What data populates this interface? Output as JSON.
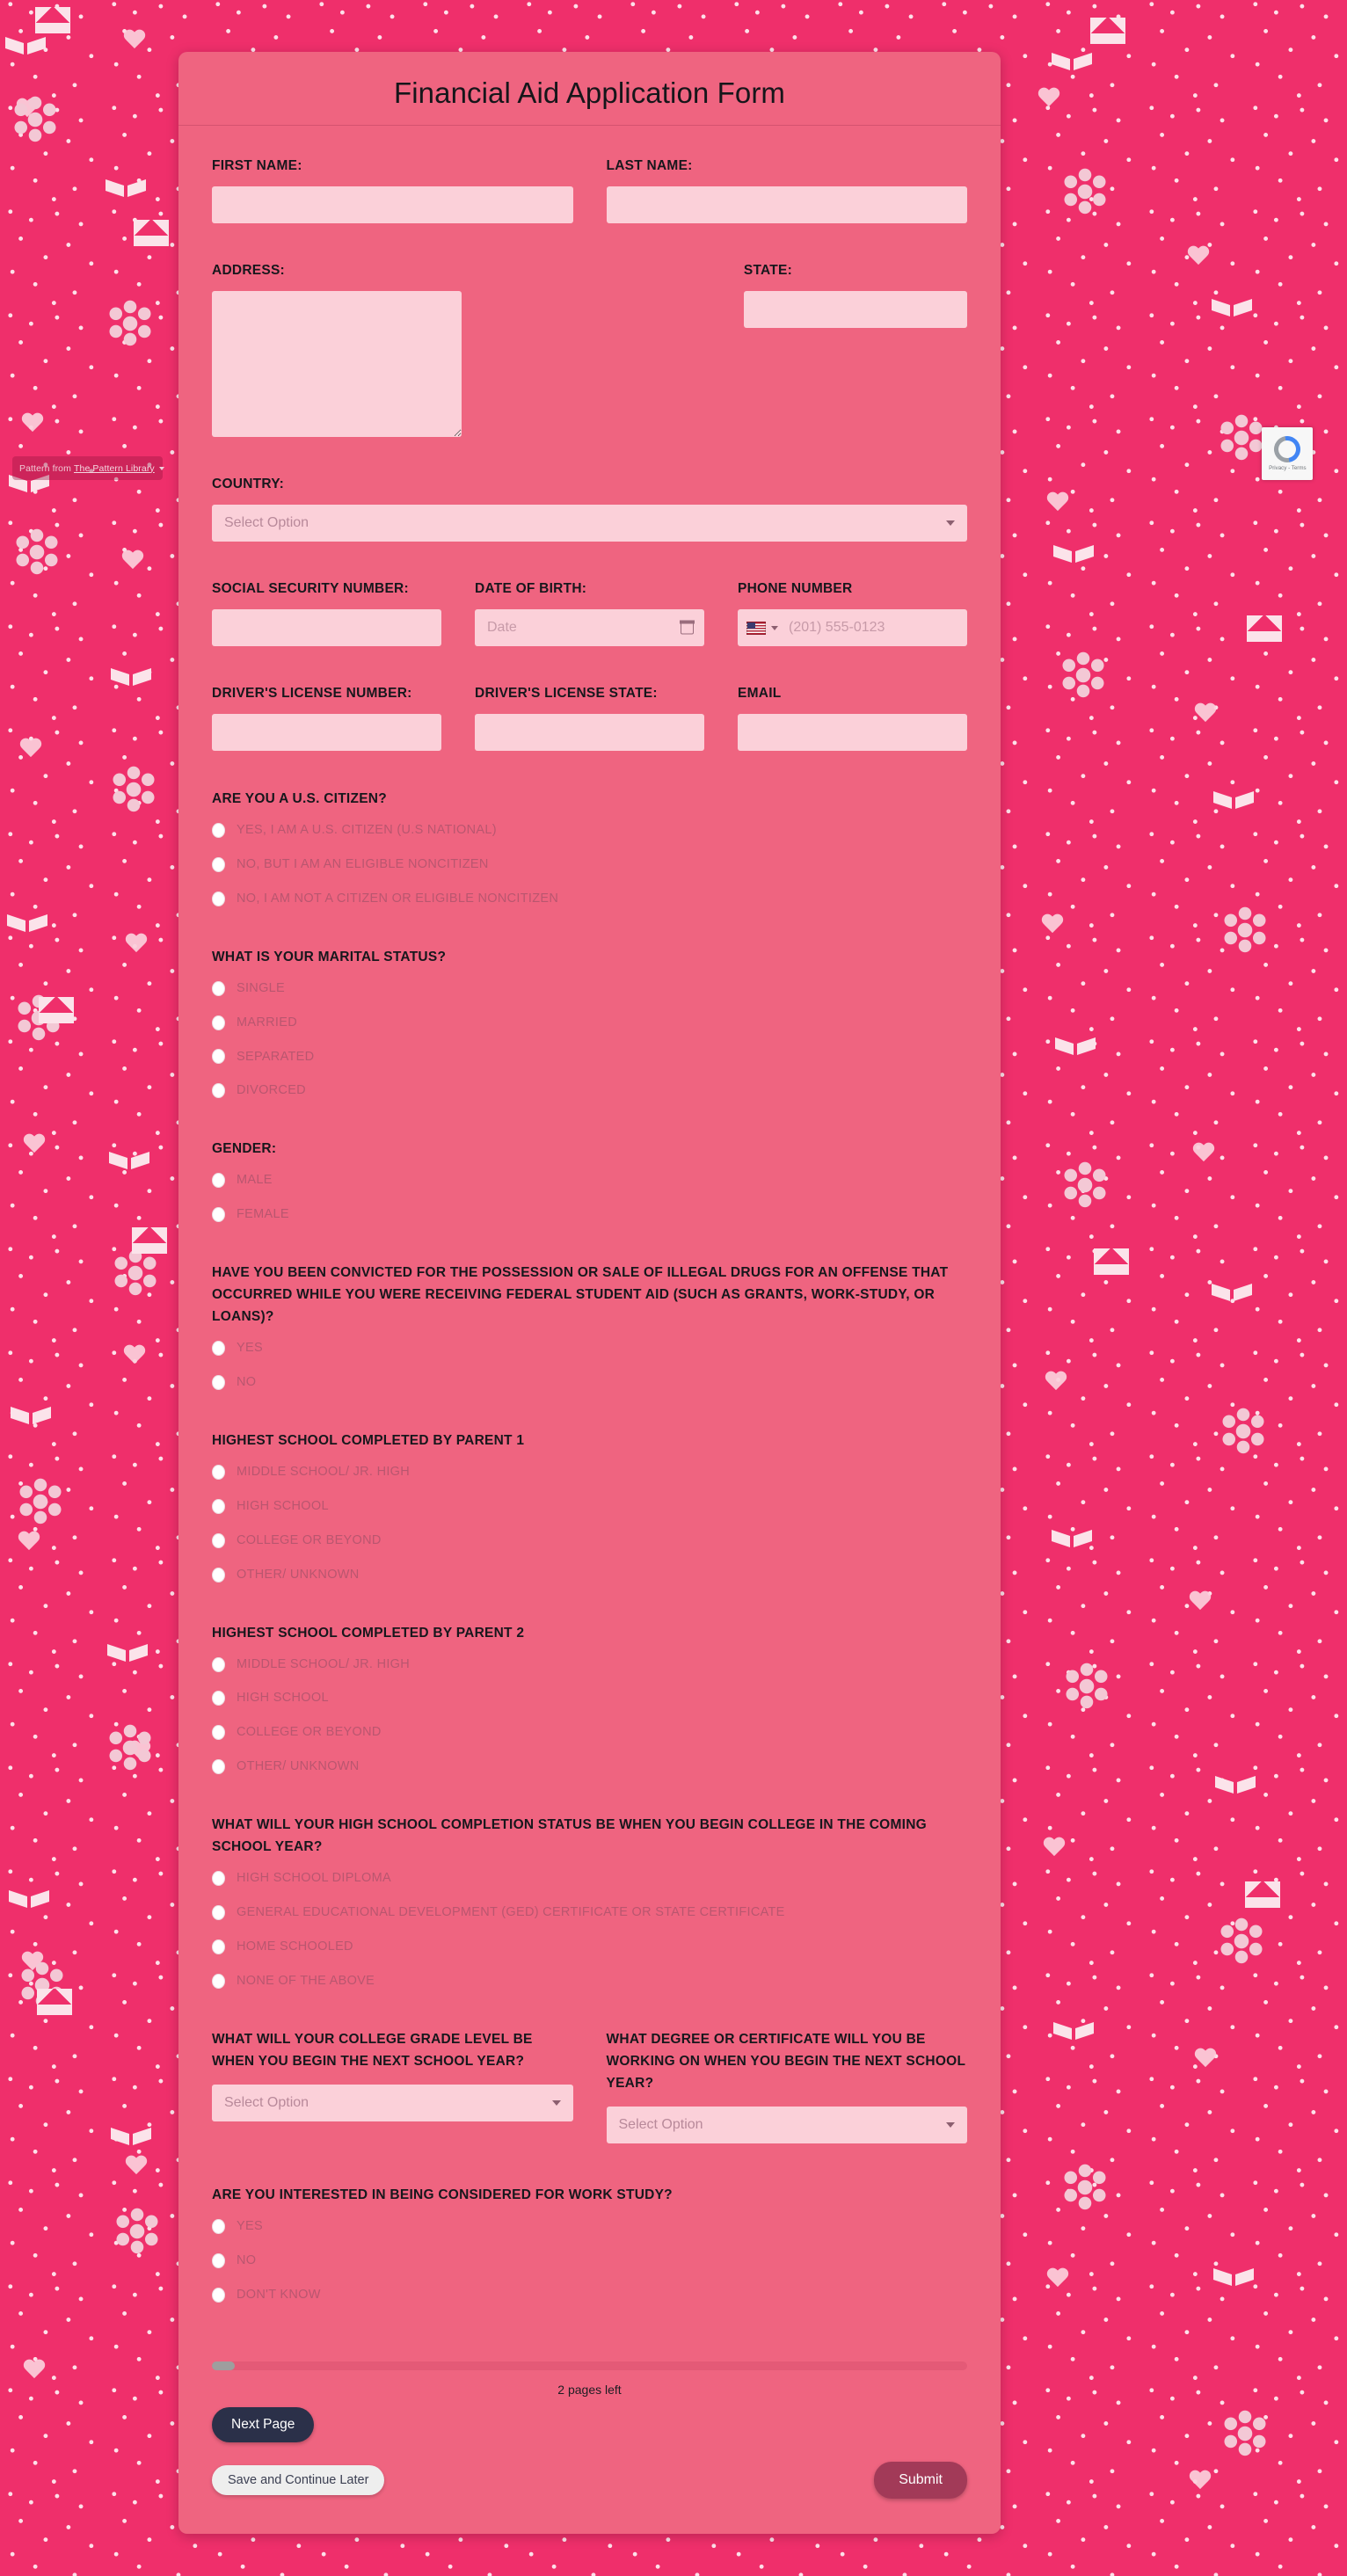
{
  "page": {
    "background_color": "#ef2f6b",
    "card_color": "#ef6480",
    "input_color": "#fbd0d9"
  },
  "header": {
    "title": "Financial Aid Application Form"
  },
  "fields": {
    "first_name": {
      "label": "FIRST NAME:",
      "value": "",
      "placeholder": ""
    },
    "last_name": {
      "label": "LAST NAME:",
      "value": "",
      "placeholder": ""
    },
    "address": {
      "label": "ADDRESS:",
      "value": "",
      "placeholder": ""
    },
    "state": {
      "label": "STATE:",
      "value": "",
      "placeholder": ""
    },
    "country": {
      "label": "COUNTRY:",
      "selected": "Select Option"
    },
    "ssn": {
      "label": "SOCIAL SECURITY NUMBER:",
      "value": "",
      "placeholder": ""
    },
    "dob": {
      "label": "DATE OF BIRTH:",
      "value": "",
      "placeholder": "Date"
    },
    "phone": {
      "label": "PHONE NUMBER",
      "value": "",
      "placeholder": "(201) 555-0123",
      "country_flag": "us-flag-icon"
    },
    "dl_number": {
      "label": "DRIVER'S LICENSE NUMBER:",
      "value": "",
      "placeholder": ""
    },
    "dl_state": {
      "label": "DRIVER'S LICENSE STATE:",
      "value": "",
      "placeholder": ""
    },
    "email": {
      "label": "EMAIL",
      "value": "",
      "placeholder": ""
    }
  },
  "questions": [
    {
      "id": "citizen",
      "label": "ARE YOU A U.S. CITIZEN?",
      "options": [
        "YES, I AM A U.S. CITIZEN (U.S NATIONAL)",
        "NO, BUT I AM AN ELIGIBLE NONCITIZEN",
        "NO, I AM NOT A CITIZEN OR ELIGIBLE NONCITIZEN"
      ]
    },
    {
      "id": "marital-status",
      "label": "WHAT IS YOUR MARITAL STATUS?",
      "options": [
        "SINGLE",
        "MARRIED",
        "SEPARATED",
        "DIVORCED"
      ]
    },
    {
      "id": "gender",
      "label": "GENDER:",
      "options": [
        "MALE",
        "FEMALE"
      ]
    },
    {
      "id": "drug-conviction",
      "label": "HAVE YOU BEEN CONVICTED FOR THE POSSESSION OR SALE OF ILLEGAL DRUGS FOR AN OFFENSE THAT OCCURRED WHILE YOU WERE RECEIVING FEDERAL STUDENT AID (SUCH AS GRANTS, WORK-STUDY, OR LOANS)?",
      "options": [
        "YES",
        "NO"
      ]
    },
    {
      "id": "parent-1-school",
      "label": "HIGHEST SCHOOL COMPLETED BY PARENT 1",
      "options": [
        "MIDDLE SCHOOL/ JR. HIGH",
        "HIGH SCHOOL",
        "COLLEGE OR BEYOND",
        "OTHER/ UNKNOWN"
      ]
    },
    {
      "id": "parent-2-school",
      "label": "HIGHEST SCHOOL COMPLETED BY PARENT 2",
      "options": [
        "MIDDLE SCHOOL/ JR. HIGH",
        "HIGH SCHOOL",
        "COLLEGE OR BEYOND",
        "OTHER/ UNKNOWN"
      ]
    },
    {
      "id": "hs-completion-status",
      "label": "WHAT WILL YOUR HIGH SCHOOL COMPLETION STATUS BE WHEN YOU BEGIN COLLEGE IN THE COMING SCHOOL YEAR?",
      "options": [
        "HIGH SCHOOL DIPLOMA",
        "GENERAL EDUCATIONAL DEVELOPMENT (GED) CERTIFICATE OR STATE CERTIFICATE",
        "HOME SCHOOLED",
        "NONE OF THE ABOVE"
      ]
    },
    {
      "id": "work-study",
      "label": "ARE YOU INTERESTED IN BEING CONSIDERED FOR WORK STUDY?",
      "options": [
        "YES",
        "NO",
        "DON'T KNOW"
      ]
    }
  ],
  "selects": {
    "grade_level": {
      "label": "WHAT WILL YOUR COLLEGE GRADE LEVEL BE WHEN YOU BEGIN THE NEXT SCHOOL YEAR?",
      "selected": "Select Option"
    },
    "degree": {
      "label": "WHAT DEGREE OR CERTIFICATE WILL YOU BE WORKING ON WHEN YOU BEGIN THE NEXT SCHOOL YEAR?",
      "selected": "Select Option"
    }
  },
  "footer": {
    "progress_percent": 3,
    "pages_left": "2 pages left",
    "next_page_label": "Next Page",
    "save_label": "Save and Continue Later",
    "submit_label": "Submit"
  },
  "overlays": {
    "pattern_credit_prefix": "Pattern from",
    "pattern_credit_link": "The Pattern Library",
    "recaptcha_text": "Privacy - Terms"
  }
}
